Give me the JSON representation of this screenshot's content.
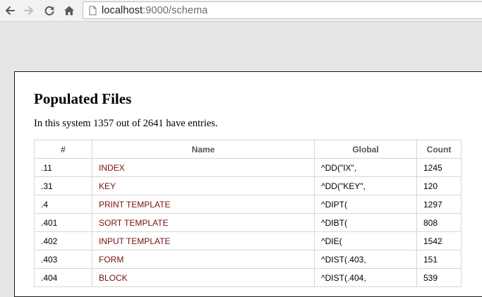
{
  "browser": {
    "url_host": "localhost",
    "url_path": ":9000/schema"
  },
  "page": {
    "title": "Populated Files",
    "summary": "In this system 1357 out of 2641 have entries."
  },
  "table": {
    "headers": [
      "#",
      "Name",
      "Global",
      "Count"
    ],
    "rows": [
      {
        "num": ".11",
        "name": "INDEX",
        "global": "^DD(\"IX\",",
        "count": "1245"
      },
      {
        "num": ".31",
        "name": "KEY",
        "global": "^DD(\"KEY\",",
        "count": "120"
      },
      {
        "num": ".4",
        "name": "PRINT TEMPLATE",
        "global": "^DIPT(",
        "count": "1297"
      },
      {
        "num": ".401",
        "name": "SORT TEMPLATE",
        "global": "^DIBT(",
        "count": "808"
      },
      {
        "num": ".402",
        "name": "INPUT TEMPLATE",
        "global": "^DIE(",
        "count": "1542"
      },
      {
        "num": ".403",
        "name": "FORM",
        "global": "^DIST(.403,",
        "count": "151"
      },
      {
        "num": ".404",
        "name": "BLOCK",
        "global": "^DIST(.404,",
        "count": "539"
      }
    ]
  },
  "icons": {
    "back": "back-arrow-icon",
    "forward": "forward-arrow-icon",
    "reload": "reload-icon",
    "home": "home-icon",
    "page": "page-icon"
  },
  "colors": {
    "name_link": "#7a1010",
    "header_text": "#555555",
    "border": "#d6d6d6"
  }
}
